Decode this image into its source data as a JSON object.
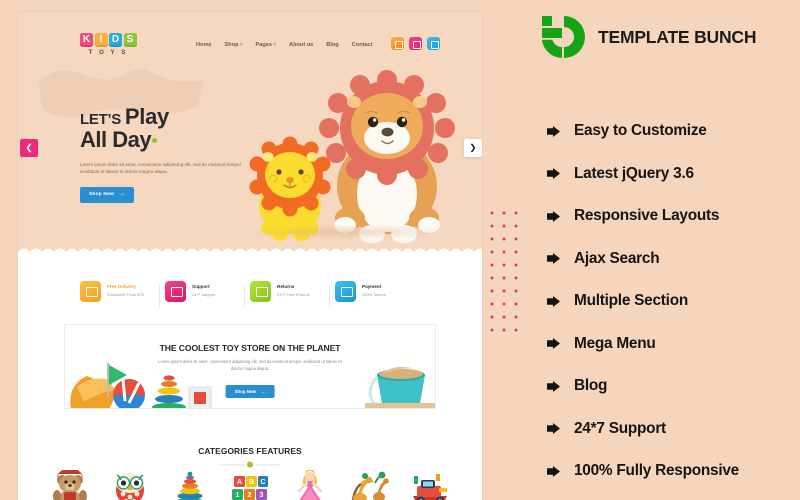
{
  "page": {
    "background_color": "#f5d6bd"
  },
  "brand": {
    "name": "TEMPLATE BUNCH",
    "logo_icon": "template-bunch-logo",
    "logo_color": "#16a315"
  },
  "features": {
    "bullet_icon": "triangle-right-icon",
    "items": [
      {
        "label": "Easy to Customize"
      },
      {
        "label": "Latest jQuery 3.6"
      },
      {
        "label": "Responsive Layouts"
      },
      {
        "label": "Ajax Search"
      },
      {
        "label": "Multiple Section"
      },
      {
        "label": "Mega Menu"
      },
      {
        "label": "Blog"
      },
      {
        "label": "24*7 Support"
      },
      {
        "label": "100% Fully Responsive"
      }
    ]
  },
  "preview": {
    "site": {
      "logo": {
        "letters": [
          "K",
          "I",
          "D",
          "S"
        ],
        "tagline": "T O Y S"
      },
      "nav": [
        {
          "label": "Home",
          "has_dropdown": false
        },
        {
          "label": "Shop",
          "has_dropdown": true
        },
        {
          "label": "Pages",
          "has_dropdown": true
        },
        {
          "label": "About us",
          "has_dropdown": false
        },
        {
          "label": "Blog",
          "has_dropdown": false
        },
        {
          "label": "Contact",
          "has_dropdown": false
        }
      ],
      "header_icons": [
        {
          "name": "search-icon",
          "color": "#f58220"
        },
        {
          "name": "account-icon",
          "color": "#e0216e"
        },
        {
          "name": "cart-icon",
          "color": "#1f9fd4"
        }
      ]
    },
    "hero": {
      "eyebrow": "LET’S",
      "headline_word": "Play",
      "headline_line2": "All Day",
      "paragraph": "Lorem ipsum dolor sit amet, consectetur adipiscing elit, sed do eiusmod tempor incididunt ut labore et dolore magna aliqua.",
      "button_label": "Shop Now",
      "button_arrow": "→",
      "button_color": "#2a8fcf",
      "prev_arrow": "❮",
      "next_arrow": "❯",
      "image_alt": "two plush lion toys"
    },
    "services": [
      {
        "title": "Free Delivery",
        "subtitle": "Worldwide From $75",
        "icon": "truck-icon",
        "color": "#f59e1f"
      },
      {
        "title": "Support",
        "subtitle": "24*7 Support",
        "icon": "headset-icon",
        "color": "#dd1165"
      },
      {
        "title": "Returns",
        "subtitle": "24*7 Free Returns",
        "icon": "refresh-icon",
        "color": "#82c31b"
      },
      {
        "title": "Payment",
        "subtitle": "100% Secure",
        "icon": "money-bag-icon",
        "color": "#1c94cf"
      }
    ],
    "promo": {
      "heading": "THE COOLEST TOY STORE ON THE PLANET",
      "paragraph": "Lorem ipsum dolor sit amet, consectetur adipiscing elit, sed do eiusmod tempor incididunt ut labore et dolore magna aliqua.",
      "button_label": "Shop Now",
      "button_arrow": "→"
    },
    "categories": {
      "heading": "CATEGORIES FEATURES",
      "items": [
        {
          "name": "teddy-bear-toy"
        },
        {
          "name": "owl-plush-toy"
        },
        {
          "name": "stacking-rings-toy"
        },
        {
          "name": "building-blocks-toy"
        },
        {
          "name": "doll-toy"
        },
        {
          "name": "giraffe-figure-toy"
        },
        {
          "name": "toy-vehicle"
        }
      ]
    }
  },
  "decoration": {
    "dot_grid_color": "#e0386f"
  }
}
